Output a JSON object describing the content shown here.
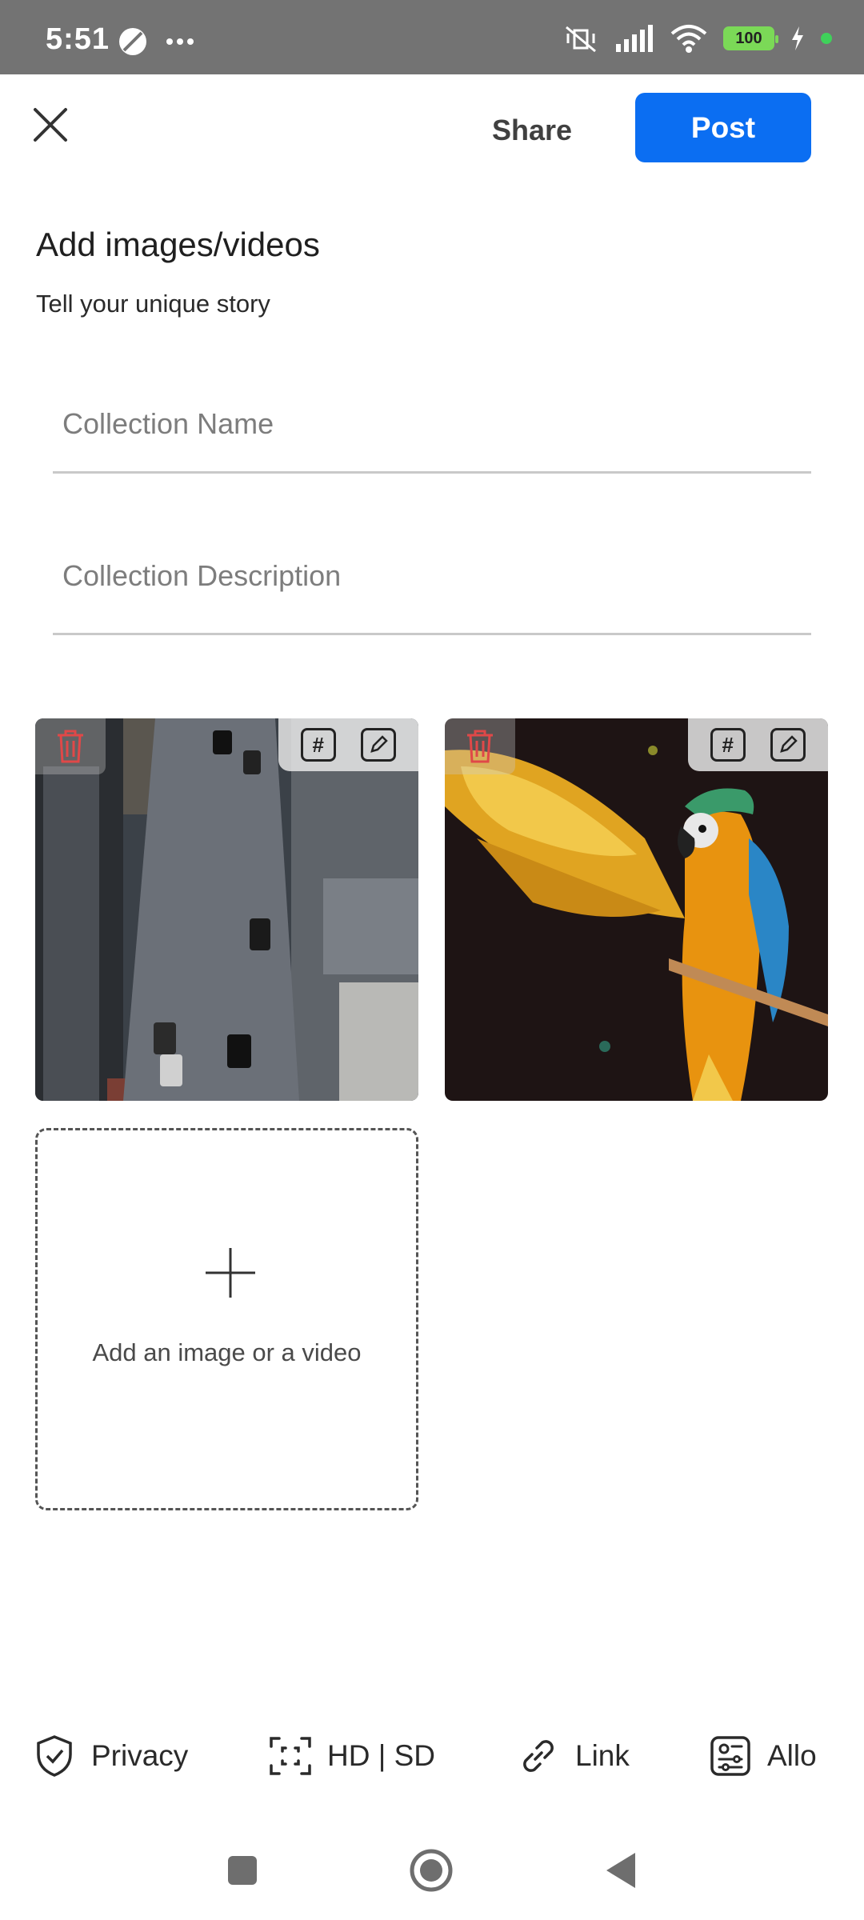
{
  "status_bar": {
    "time": "5:51",
    "battery": "100"
  },
  "header": {
    "share_label": "Share",
    "post_label": "Post"
  },
  "page": {
    "title": "Add images/videos",
    "subtitle": "Tell your unique story"
  },
  "form": {
    "name_placeholder": "Collection Name",
    "description_placeholder": "Collection Description"
  },
  "media": {
    "tag_symbol": "#",
    "add_label": "Add an image or a video"
  },
  "toolbar": {
    "privacy": "Privacy",
    "quality": "HD | SD",
    "link": "Link",
    "allow": "Allo"
  },
  "colors": {
    "accent": "#0b6ef2",
    "status_bar": "#737373",
    "delete": "#e04848"
  }
}
